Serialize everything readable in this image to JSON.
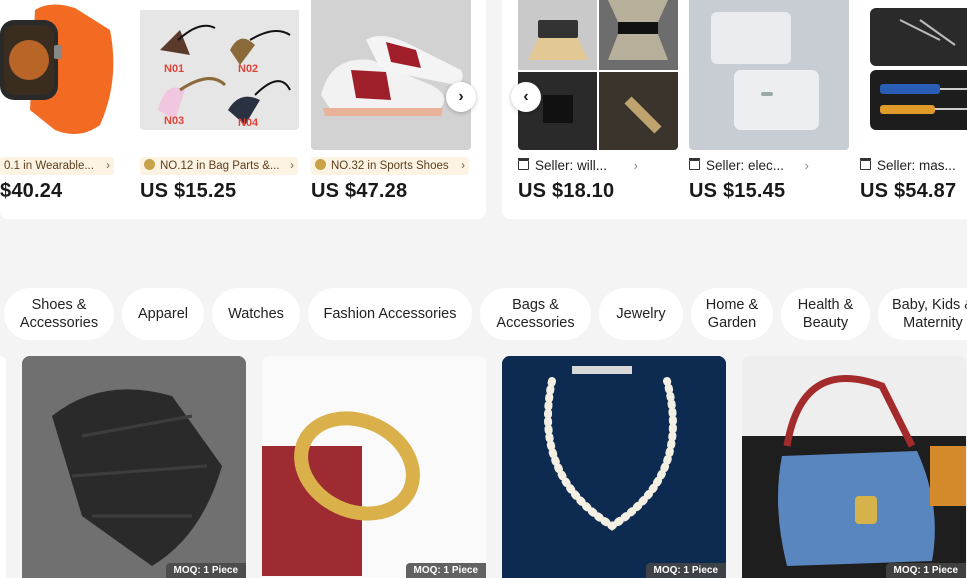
{
  "top_left_cards": [
    {
      "rank": "0.1 in Wearable...",
      "price": "$40.24"
    },
    {
      "rank": "NO.12 in Bag Parts &...",
      "price": "US $15.25",
      "tag_labels": [
        "N01",
        "N02",
        "N03",
        "N04"
      ]
    },
    {
      "rank": "NO.32 in Sports Shoes",
      "price": "US $47.28"
    }
  ],
  "top_right_cards": [
    {
      "seller": "Seller: will...",
      "price": "US $18.10"
    },
    {
      "seller": "Seller: elec...",
      "price": "US $15.45"
    },
    {
      "seller": "Seller: mas...",
      "price": "US $54.87"
    }
  ],
  "nav": {
    "next_label": "›",
    "prev_label": "‹"
  },
  "categories": [
    "Shoes &\nAccessories",
    "Apparel",
    "Watches",
    "Fashion Accessories",
    "Bags &\nAccessories",
    "Jewelry",
    "Home &\nGarden",
    "Health &\nBeauty",
    "Baby, Kids &\nMaternity"
  ],
  "products": [
    {
      "moq": "MOQ: 1 Piece"
    },
    {
      "moq": "MOQ: 1 Piece"
    },
    {
      "moq": "MOQ: 1 Piece"
    },
    {
      "moq": "MOQ: 1 Piece"
    }
  ],
  "colors": {
    "accent": "#f5821f",
    "rank_bg": "#fdf3e2",
    "page_bg": "#f4f4f4"
  }
}
